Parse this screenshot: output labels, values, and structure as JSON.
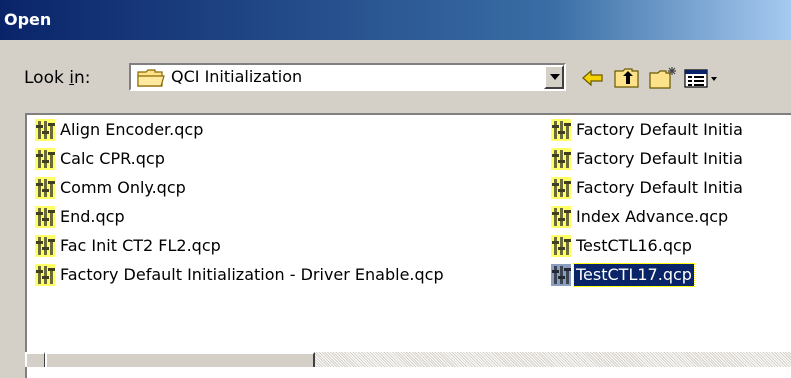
{
  "dialog": {
    "title": "Open"
  },
  "look_in": {
    "label": "Look in:",
    "label_hotkey": "i",
    "selected_folder": "QCI Initialization",
    "folder_icon": "folder-icon"
  },
  "toolbar": {
    "back_icon": "back-arrow-icon",
    "up_icon": "up-one-level-icon",
    "new_folder_icon": "new-folder-icon",
    "view_menu_icon": "view-menu-icon"
  },
  "files": {
    "column1": [
      {
        "name": "Align Encoder.qcp",
        "selected": false
      },
      {
        "name": "Calc CPR.qcp",
        "selected": false
      },
      {
        "name": "Comm Only.qcp",
        "selected": false
      },
      {
        "name": "End.qcp",
        "selected": false
      },
      {
        "name": "Fac Init CT2 FL2.qcp",
        "selected": false
      },
      {
        "name": "Factory Default Initialization - Driver Enable.qcp",
        "selected": false
      }
    ],
    "column2": [
      {
        "name": "Factory Default Initia",
        "selected": false
      },
      {
        "name": "Factory Default Initia",
        "selected": false
      },
      {
        "name": "Factory Default Initia",
        "selected": false
      },
      {
        "name": "Index Advance.qcp",
        "selected": false
      },
      {
        "name": "TestCTL16.qcp",
        "selected": false
      },
      {
        "name": "TestCTL17.qcp",
        "selected": true
      }
    ],
    "file_icon": "qcp-file-icon"
  },
  "colors": {
    "titlebar_start": "#0a246a",
    "titlebar_end": "#a6caf0",
    "selection": "#0a246a",
    "dialog_bg": "#d4d0c8"
  }
}
